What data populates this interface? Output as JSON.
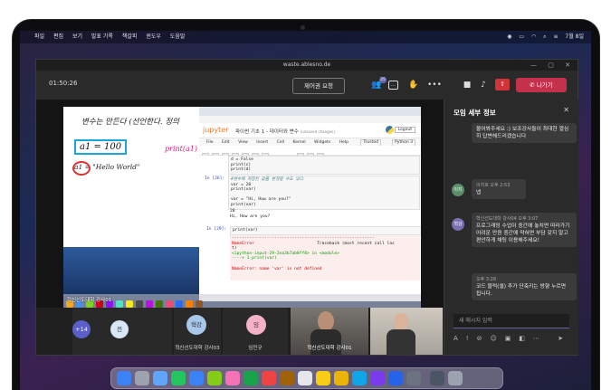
{
  "menubar": {
    "items": [
      "파일",
      "편집",
      "보기",
      "발표 기록",
      "책갈피",
      "윈도우",
      "도움말"
    ],
    "clock": "7월 8일"
  },
  "window": {
    "title": "waste.ablesno.de",
    "min": "—",
    "max": "▢",
    "close": "✕"
  },
  "toolbar": {
    "timer": "01:50:26",
    "control_request": "제어권 요청",
    "participants_badge": "25",
    "leave": "나가기"
  },
  "whiteboard": {
    "line1": "변수는 만든다 (선언한다. 정의",
    "line2": "a1 = 100",
    "line3": "print(a1)",
    "line4": "a1 = \"Hello World\""
  },
  "jupyter": {
    "logo": "jupyter",
    "notebook_title": "파이썬 기초 1 - 데이터와 변수",
    "autosave": "(unsaved changes)",
    "logout": "Logout",
    "menu": [
      "File",
      "Edit",
      "View",
      "Insert",
      "Cell",
      "Kernel",
      "Widgets",
      "Help"
    ],
    "trusted": "Trusted",
    "kernel": "Python 3",
    "run": "Run",
    "cell_type": "Code",
    "cells": [
      {
        "prompt": "",
        "code": "d = False\nprint(c)\nprint(d)"
      },
      {
        "prompt": "In [26]:",
        "code_comment": "#변수에 저장된 값을 변경할 수도 있다",
        "code_lines": [
          "var = 20",
          "print(var)",
          "",
          "var = \"Hi, How are you?\"",
          "print(var)"
        ],
        "output": "20\nHi, How are you?"
      },
      {
        "prompt": "In [29]:",
        "code": "print(var)",
        "error_title": "NameError",
        "traceback": "Traceback (most recent call las",
        "err_lines": [
          "t)",
          "<ipython-input-29-2ea3b7ab8ff8> in <module>",
          "----> 1 print(var)"
        ],
        "error_msg": "NameError: name 'var' is not defined"
      }
    ]
  },
  "stage": {
    "sharer": "혁신선도대학 강사01"
  },
  "participants": [
    {
      "initial": "+14",
      "name": ""
    },
    {
      "initial": "전",
      "name": ""
    },
    {
      "initial": "혁강",
      "name": "혁신선도대학 강사03"
    },
    {
      "initial": "임",
      "name": "임민규"
    },
    {
      "initial": "",
      "name": "혁신선도대학 강사01"
    },
    {
      "initial": "",
      "name": ""
    }
  ],
  "panel": {
    "title": "모임 세부 정보",
    "messages": [
      {
        "meta": "",
        "text": "물어봐주세요 :) 보조강사들이 최대한 열심히 답변해드리겠습니다"
      },
      {
        "avatar": "이지",
        "meta": "이지호  오후 2:53",
        "text": "넵"
      },
      {
        "avatar": "혁강",
        "meta": "혁신선도대학 강사04  오후 3:07",
        "text": "프로그래밍 수업이 중간에 놓치면 따라가기 어려운 만큼 중간에 막혀면 부담 갖지 말고 편안하게 채팅 이용해주세요!"
      },
      {
        "meta": "오후 3:28",
        "text": "코드 블럭(셀) 추가 단축키는 방향 누르면 됩니다."
      }
    ],
    "input_placeholder": "새 메시지 입력"
  },
  "colors": {
    "accent": "#6264a7",
    "leave": "#c4314b"
  }
}
